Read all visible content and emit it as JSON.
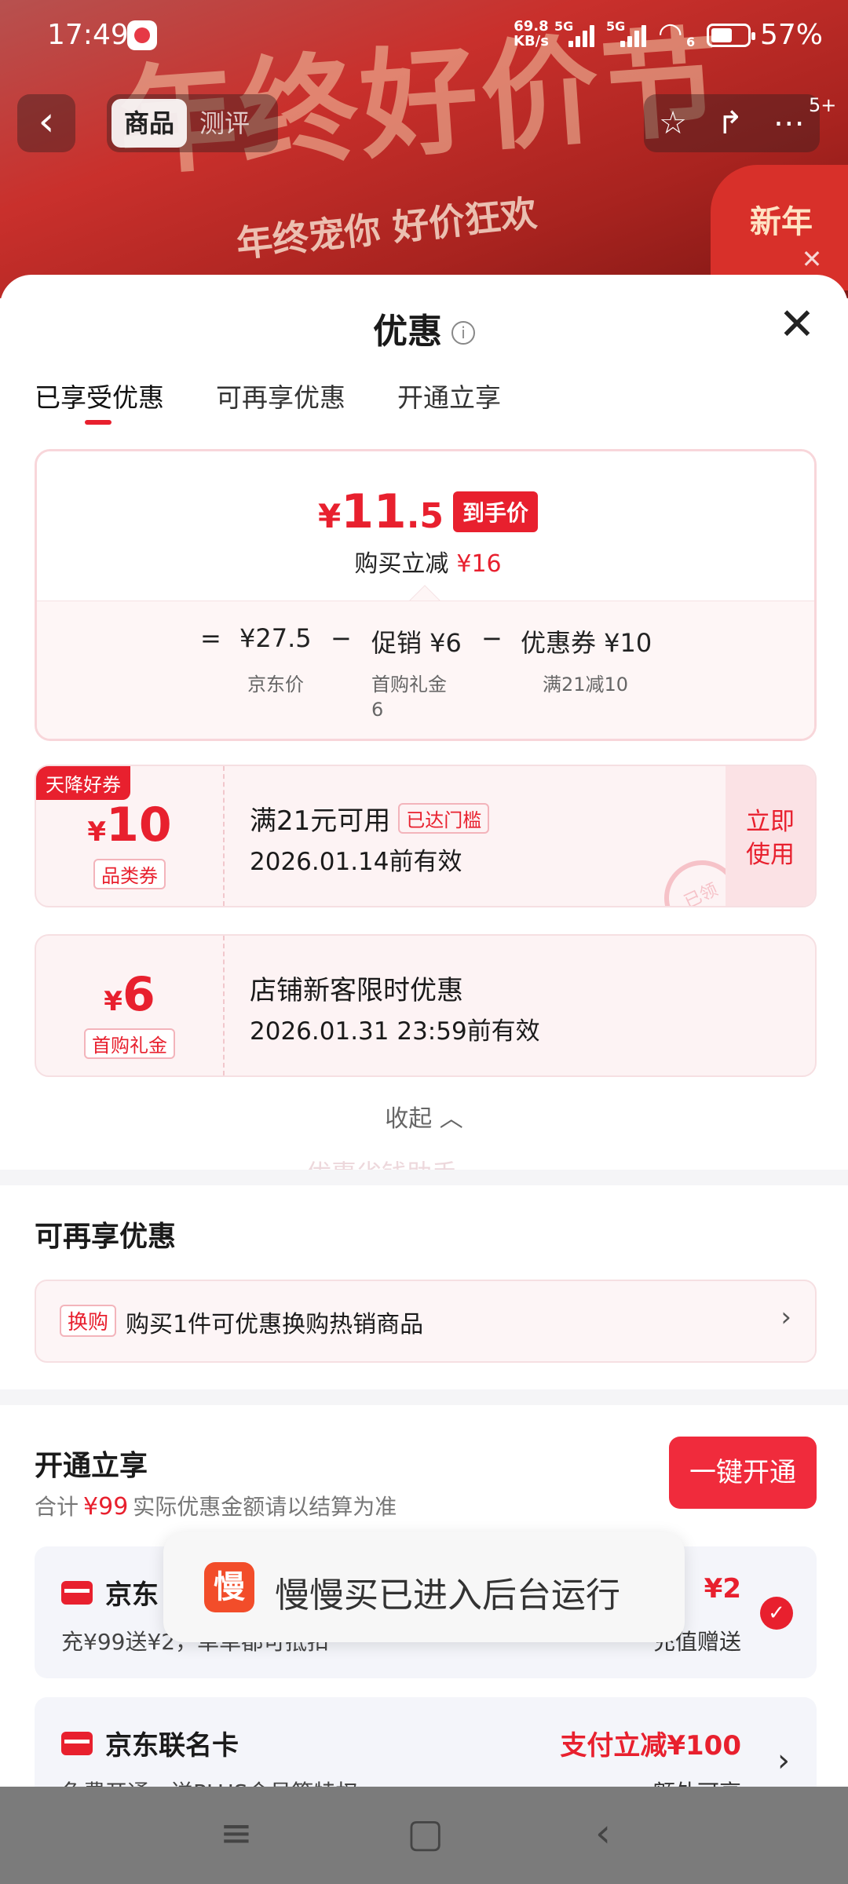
{
  "status_bar": {
    "time": "17:49",
    "net_speed": "69.8",
    "net_speed_unit": "KB/s",
    "sig1_label": "5G",
    "sig2_label": "5G",
    "wifi_sub": "6",
    "battery": "57%"
  },
  "banner": {
    "headline": "年终好价节",
    "slogan": "年终宠你 好价狂欢",
    "corner": "新年",
    "badge": "5+"
  },
  "nav": {
    "tabs": [
      "商品",
      "测评"
    ]
  },
  "sheet": {
    "title": "优惠",
    "tabs": [
      "已享受优惠",
      "可再享优惠",
      "开通立享"
    ]
  },
  "price_card": {
    "currency": "¥",
    "final_int": "11",
    "final_dec": ".5",
    "final_tag": "到手价",
    "reduce_label": "购买立减",
    "reduce_amount": "¥16",
    "eq": "=",
    "minus": "−",
    "base_price": "¥27.5",
    "base_label": "京东价",
    "promo_price": "促销 ¥6",
    "promo_label": "首购礼金",
    "promo_label2": "6",
    "coupon_price": "优惠券 ¥10",
    "coupon_label": "满21减10"
  },
  "coupons": [
    {
      "ribbon": "天降好券",
      "currency": "¥",
      "amount": "10",
      "kind": "品类券",
      "title": "满21元可用",
      "reach_tag": "已达门槛",
      "valid": "2026.01.14前有效",
      "use_btn_l1": "立即",
      "use_btn_l2": "使用",
      "stamp": "已领"
    },
    {
      "currency": "¥",
      "amount": "6",
      "kind": "首购礼金",
      "title": "店铺新客限时优惠",
      "valid": "2026.01.31 23:59前有效"
    }
  ],
  "watermark": "优惠省钱助手",
  "collapse_label": "收起",
  "more_offers": {
    "title": "可再享优惠",
    "tag": "换购",
    "text": "购买1件可优惠换购热销商品"
  },
  "open_section": {
    "title": "开通立享",
    "button": "一键开通",
    "total_label": "合计",
    "total_amount": "¥99",
    "total_note": "实际优惠金额请以结算为准",
    "cards": [
      {
        "name": "京东",
        "desc": "充¥99送¥2，单单都可抵扣",
        "value": "¥2",
        "sub": "充值赠送"
      },
      {
        "name": "京东联名卡",
        "desc": "免费开通，送PLUS会员等特权",
        "value": "支付立减¥100",
        "sub": "额外可享"
      }
    ]
  },
  "toast": {
    "logo": "慢",
    "message": "慢慢买已进入后台运行"
  }
}
